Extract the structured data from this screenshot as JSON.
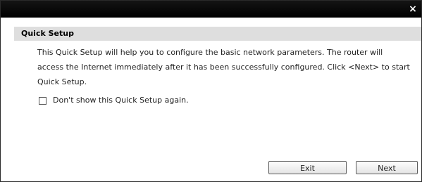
{
  "dialog": {
    "close_symbol": "×",
    "section_title": "Quick Setup",
    "description": "This Quick Setup will help you to configure the basic network parameters. The router will access the Internet immediately after it has been successfully configured. Click <Next> to start Quick Setup.",
    "checkbox": {
      "label": "Don't show this Quick Setup again.",
      "checked": false
    },
    "buttons": {
      "exit": "Exit",
      "next": "Next"
    }
  },
  "colors": {
    "titlebar": "#000000",
    "section_bar": "#dedede",
    "close_glyph": "#ffffff"
  }
}
